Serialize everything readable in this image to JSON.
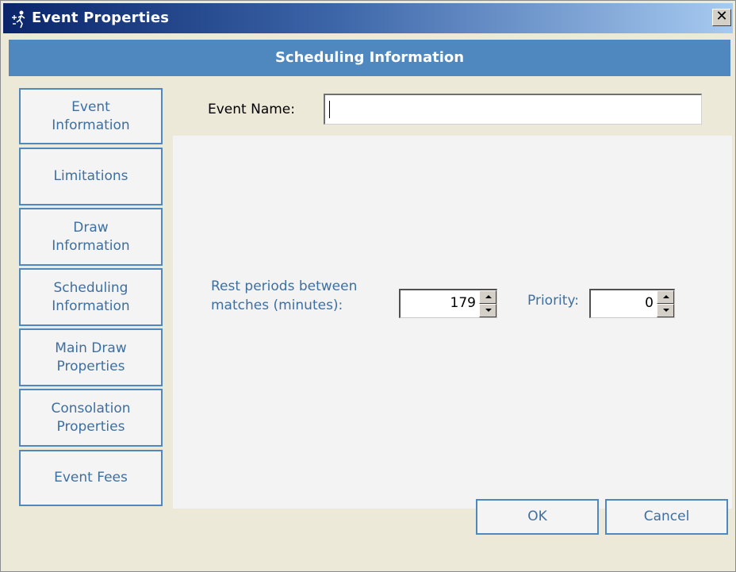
{
  "window": {
    "title": "Event Properties",
    "title_icon": "tournament-figures-icon",
    "close_glyph": "✕"
  },
  "header": {
    "title": "Scheduling Information"
  },
  "sidebar": {
    "items": [
      {
        "label": "Event\nInformation"
      },
      {
        "label": "Limitations"
      },
      {
        "label": "Draw\nInformation"
      },
      {
        "label": "Scheduling\nInformation"
      },
      {
        "label": "Main Draw\nProperties"
      },
      {
        "label": "Consolation\nProperties"
      },
      {
        "label": "Event Fees"
      }
    ]
  },
  "form": {
    "event_name_label": "Event Name:",
    "event_name_value": "",
    "rest_label_line1": "Rest periods between",
    "rest_label_line2": "matches (minutes):",
    "rest_value": "179",
    "priority_label": "Priority:",
    "priority_value": "0"
  },
  "buttons": {
    "ok": "OK",
    "cancel": "Cancel"
  },
  "colors": {
    "accent": "#4f88be",
    "label_blue": "#3d6fa1",
    "window_bg": "#ece9d8"
  }
}
